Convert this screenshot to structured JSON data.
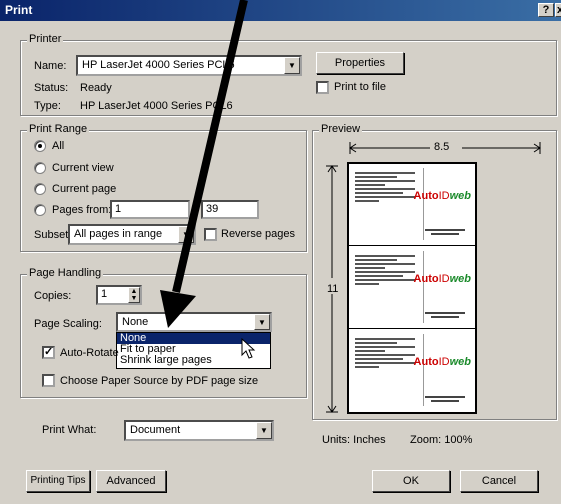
{
  "title": "Print",
  "title_buttons": {
    "help": "?",
    "close": "x"
  },
  "printer": {
    "group": "Printer",
    "name_label": "Name:",
    "name_value": "HP LaserJet 4000 Series PCL6",
    "status_label": "Status:",
    "status_value": "Ready",
    "type_label": "Type:",
    "type_value": "HP LaserJet 4000 Series PCL6",
    "properties": "Properties",
    "print_to_file": "Print to file"
  },
  "range": {
    "group": "Print Range",
    "all": "All",
    "current_view": "Current view",
    "current_page": "Current page",
    "pages_from": "Pages from:",
    "from_value": "1",
    "to_value": "39",
    "subset_label": "Subset:",
    "subset_value": "All pages in range",
    "reverse": "Reverse pages"
  },
  "handling": {
    "group": "Page Handling",
    "copies_label": "Copies:",
    "copies_value": "1",
    "scaling_label": "Page Scaling:",
    "scaling_value": "None",
    "scaling_options": [
      "None",
      "Fit to paper",
      "Shrink large pages"
    ],
    "auto_rotate": "Auto-Rotate",
    "paper_source": "Choose Paper Source by PDF page size"
  },
  "print_what": {
    "label": "Print What:",
    "value": "Document"
  },
  "preview": {
    "group": "Preview",
    "width": "8.5",
    "height": "11",
    "units": "Units: Inches",
    "zoom": "Zoom: 100%",
    "brand_a": "Auto",
    "brand_b": "ID",
    "brand_c": "web"
  },
  "buttons": {
    "tips": "Printing Tips",
    "advanced": "Advanced",
    "ok": "OK",
    "cancel": "Cancel"
  }
}
